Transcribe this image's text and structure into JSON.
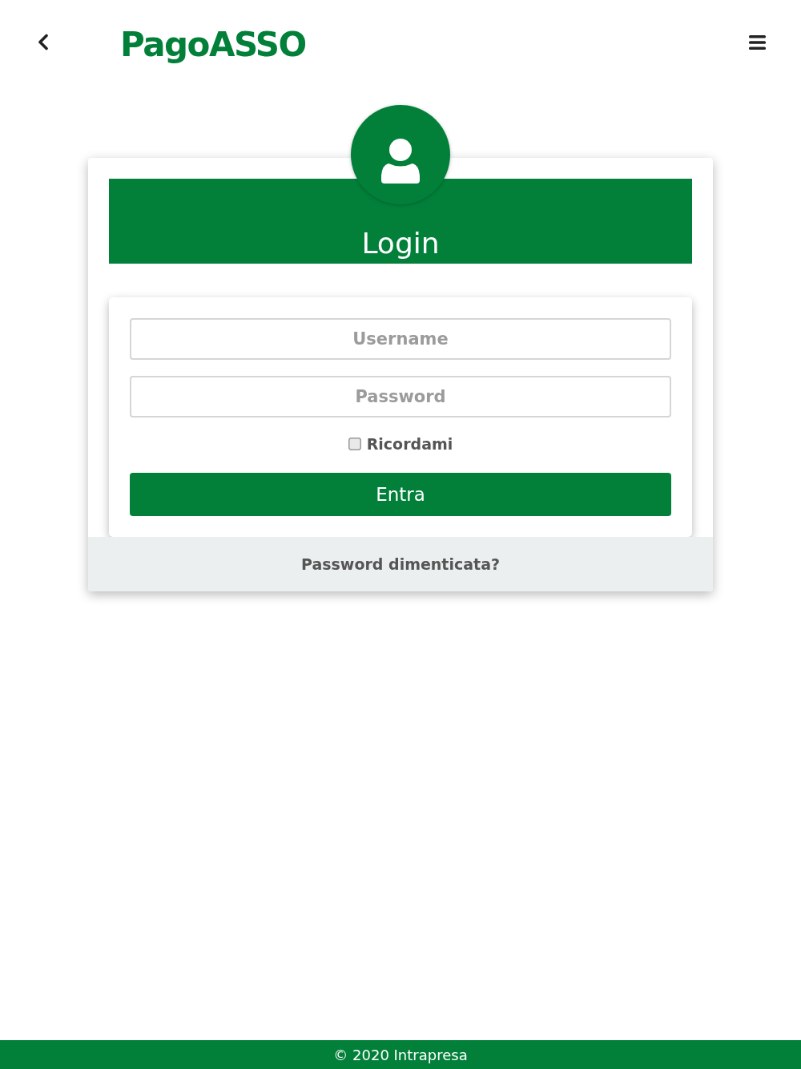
{
  "header": {
    "logo": "PagoASSO"
  },
  "login_card": {
    "title": "Login",
    "fields": [
      {
        "placeholder": "Username"
      },
      {
        "placeholder": "Password"
      }
    ],
    "remember": {
      "label": "Ricordami",
      "checked": false
    },
    "submit": "Entra",
    "forgot_link": "Password dimenticata?"
  },
  "footer": {
    "copyright": "© 2020 Intrapresa"
  }
}
